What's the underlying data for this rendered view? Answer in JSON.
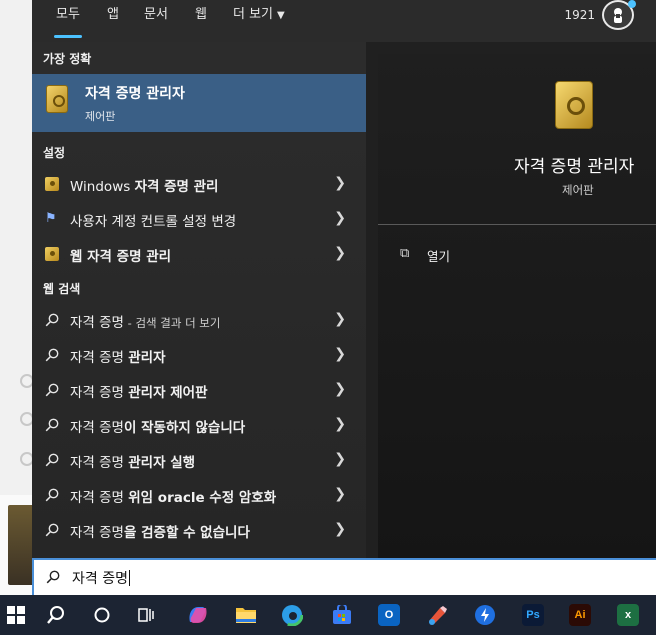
{
  "tabs": [
    {
      "label": "모두",
      "active": true
    },
    {
      "label": "앱"
    },
    {
      "label": "문서"
    },
    {
      "label": "웹"
    },
    {
      "label": "더 보기"
    }
  ],
  "header": {
    "points": "1921"
  },
  "sections": {
    "best": "가장 정확",
    "settings": "설정",
    "web": "웹 검색"
  },
  "best_match": {
    "title": "자격 증명 관리자",
    "subtitle": "제어판",
    "icon": "credential-manager-icon"
  },
  "settings_items": [
    {
      "pre": "Windows ",
      "bold": "자격 증명 관리",
      "icon": "credential-icon"
    },
    {
      "pre": "",
      "bold": "",
      "plain": "사용자 계정 컨트롤 설정 변경",
      "icon": "uac-flag-icon"
    },
    {
      "pre": "",
      "bold": "웹 자격 증명 관리",
      "icon": "credential-icon"
    }
  ],
  "web_items": [
    {
      "pre": "자격 증명",
      "bold": "",
      "suffix": " - 검색 결과 더 보기"
    },
    {
      "pre": "자격 증명 ",
      "bold": "관리자",
      "suffix": ""
    },
    {
      "pre": "자격 증명 ",
      "bold": "관리자 제어판",
      "suffix": ""
    },
    {
      "pre": "자격 증명",
      "bold": "이 작동하지 않습니다",
      "suffix": ""
    },
    {
      "pre": "자격 증명 ",
      "bold": "관리자 실행",
      "suffix": ""
    },
    {
      "pre": "자격 증명 ",
      "bold": "위임 oracle 수정 암호화",
      "suffix": ""
    },
    {
      "pre": "자격 증명",
      "bold": "을 검증할 수 없습니다",
      "suffix": ""
    }
  ],
  "preview": {
    "title": "자격 증명 관리자",
    "subtitle": "제어판",
    "open_label": "열기"
  },
  "search": {
    "value": "자격 증명"
  },
  "taskbar": [
    {
      "name": "windows-start-icon"
    },
    {
      "name": "search-icon"
    },
    {
      "name": "cortana-icon"
    },
    {
      "name": "task-view-icon"
    },
    {
      "name": "copilot-icon"
    },
    {
      "name": "file-explorer-icon"
    },
    {
      "name": "edge-icon"
    },
    {
      "name": "microsoft-store-icon"
    },
    {
      "name": "outlook-icon"
    },
    {
      "name": "paint-icon"
    },
    {
      "name": "arrow-app-icon"
    },
    {
      "name": "photoshop-icon",
      "label": "Ps"
    },
    {
      "name": "illustrator-icon",
      "label": "Ai"
    },
    {
      "name": "excel-icon",
      "label": "x"
    }
  ],
  "colors": {
    "accent": "#4cc2ff",
    "selected": "#3a5f86",
    "panel": "#202020",
    "taskbar": "#1c2433"
  }
}
